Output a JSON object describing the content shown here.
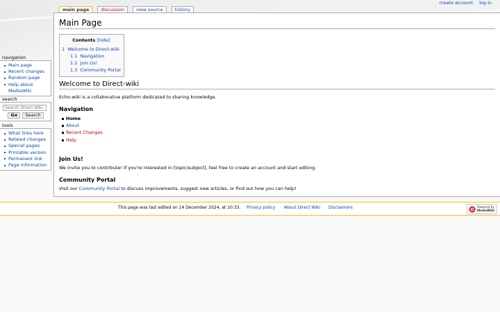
{
  "personal_tools": {
    "create_account": "create account",
    "log_in": "log in"
  },
  "tabs": [
    {
      "label": "main page"
    },
    {
      "label": "discussion"
    },
    {
      "label": "view source"
    },
    {
      "label": "history"
    }
  ],
  "page_title": "Main Page",
  "toc": {
    "title": "Contents",
    "hide_label": "[hide]",
    "items": [
      {
        "number": "1",
        "label": "Welcome to Direct-wiki"
      },
      {
        "number": "1.1",
        "label": "Navigation"
      },
      {
        "number": "1.2",
        "label": "Join Us!"
      },
      {
        "number": "1.3",
        "label": "Community Portal"
      }
    ]
  },
  "article": {
    "welcome_heading": "Welcome to Direct-wiki",
    "intro": "Echo-wiki is a collaborative platform dedicated to sharing knowledge.",
    "navigation_heading": "Navigation",
    "nav_links": [
      "Home",
      "About",
      "Recent Changes",
      "Help"
    ],
    "join_heading": "Join Us!",
    "join_text": "We invite you to contribute! If you're interested in [topic/subject], feel free to create an account and start editing.",
    "portal_heading": "Community Portal",
    "portal_text_before": "Visit our ",
    "portal_link": "Community Portal",
    "portal_text_after": " to discuss improvements, suggest new articles, or find out how you can help!"
  },
  "sidebar": {
    "navigation": {
      "title": "navigation",
      "items": [
        "Main page",
        "Recent changes",
        "Random page",
        "Help about MediaWiki"
      ]
    },
    "search": {
      "title": "search",
      "placeholder": "Search Direct Wiki",
      "go_label": "Go",
      "search_label": "Search"
    },
    "tools": {
      "title": "tools",
      "items": [
        "What links here",
        "Related changes",
        "Special pages",
        "Printable version",
        "Permanent link",
        "Page information"
      ]
    }
  },
  "footer": {
    "last_edited": "This page was last edited on 14 December 2024, at 10:33.",
    "privacy": "Privacy policy",
    "about": "About Direct Wiki",
    "disclaimers": "Disclaimers",
    "powered_line1": "Powered by",
    "powered_line2": "MediaWiki"
  },
  "colors": {
    "link": "#0645ad",
    "new_link": "#ba0000",
    "accent": "#fabd23"
  }
}
